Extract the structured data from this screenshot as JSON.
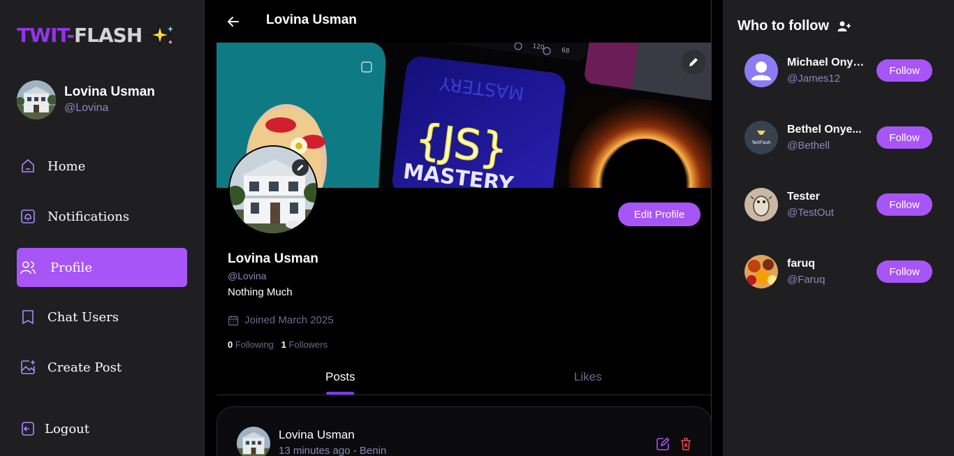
{
  "app": {
    "logo_part1": "TWIT-",
    "logo_part2": "FLASH",
    "accent": "#a855f7"
  },
  "current_user": {
    "name": "Lovina Usman",
    "handle": "@Lovina"
  },
  "sidebar": {
    "items": [
      {
        "label": "Home",
        "icon": "home-icon",
        "active": false
      },
      {
        "label": "Notifications",
        "icon": "notifications-icon",
        "active": false
      },
      {
        "label": "Profile",
        "icon": "profile-icon",
        "active": true
      },
      {
        "label": "Chat Users",
        "icon": "chat-icon",
        "active": false
      },
      {
        "label": "Create Post",
        "icon": "create-post-icon",
        "active": false
      }
    ],
    "logout": "Logout"
  },
  "header": {
    "title": "Lovina Usman"
  },
  "cover": {
    "stat_likes": "120",
    "stat_comments": "68",
    "js_text": "{JS}",
    "mastery_text": "MASTERY",
    "mastery_mirror": "MASTERY"
  },
  "profile": {
    "name": "Lovina Usman",
    "handle": "@Lovina",
    "bio": "Nothing Much",
    "joined": "Joined March 2025",
    "following_count": "0",
    "following_label": "Following",
    "followers_count": "1",
    "followers_label": "Followers",
    "edit_label": "Edit Profile"
  },
  "tabs": [
    "Posts",
    "Likes"
  ],
  "post": {
    "author": "Lovina Usman",
    "meta": "13 minutes ago  -  Benin"
  },
  "who_to_follow": {
    "title": "Who to follow",
    "follow_label": "Follow",
    "users": [
      {
        "name": "Michael Onye...",
        "handle": "@James12"
      },
      {
        "name": "Bethel Onye...",
        "handle": "@Bethell",
        "avatar_text": "TwitFlash"
      },
      {
        "name": "Tester",
        "handle": "@TestOut"
      },
      {
        "name": "faruq",
        "handle": "@Faruq"
      }
    ]
  }
}
